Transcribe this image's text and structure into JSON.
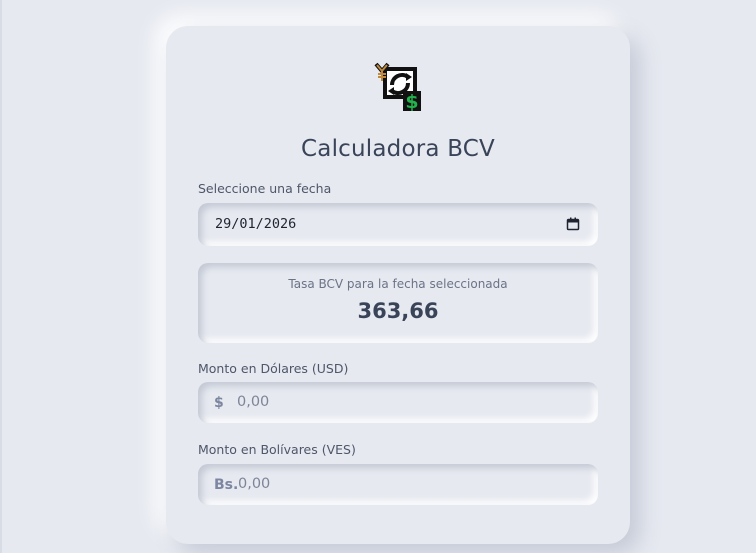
{
  "app": {
    "title": "Calculadora BCV",
    "logo_icon": "currency-exchange-icon"
  },
  "date_field": {
    "label": "Seleccione una fecha",
    "value": "29/01/2026",
    "icon": "calendar-icon"
  },
  "rate": {
    "label": "Tasa BCV para la fecha seleccionada",
    "value": "363,66"
  },
  "usd_field": {
    "label": "Monto en Dólares (USD)",
    "prefix": "$",
    "placeholder": "0,00"
  },
  "ves_field": {
    "label": "Monto en Bolívares (VES)",
    "prefix": "Bs.",
    "placeholder": "0,00"
  },
  "colors": {
    "background": "#e6e9f0",
    "text_primary": "#3a4459",
    "accent_green": "#22b14c",
    "accent_gold": "#c08a3e"
  }
}
